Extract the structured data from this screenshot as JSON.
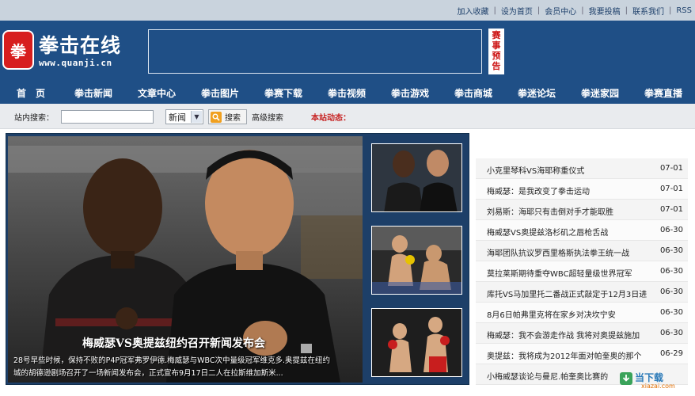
{
  "site": {
    "logo_title": "拳击在线",
    "logo_mark": "拳",
    "logo_url": "www.quanji.cn",
    "promo_tag": "赛事预告"
  },
  "top_links": [
    "加入收藏",
    "设为首页",
    "会员中心",
    "我要投稿",
    "联系我们",
    "RSS"
  ],
  "nav": [
    "首　页",
    "拳击新闻",
    "文章中心",
    "拳击图片",
    "拳赛下载",
    "拳击视频",
    "拳击游戏",
    "拳击商城",
    "拳迷论坛",
    "拳迷家园",
    "拳赛直播"
  ],
  "search": {
    "label": "站内搜索：",
    "value": "",
    "category": "新闻",
    "button": "搜索",
    "advanced": "高级搜索",
    "dynamic_label": "本站动态："
  },
  "slider": {
    "main_title": "梅威瑟VS奥提兹纽约召开新闻发布会",
    "main_text_line1": "28号早些时候，保持不败的P4P冠军弗罗伊德.梅威瑟与WBC次中量级冠军维克多.奥提兹在纽约",
    "main_text_line2": "城的胡德逊剧场召开了一场新闻发布会，正式宣布9月17日二人在拉斯维加斯米..."
  },
  "news": [
    {
      "title": "小克里琴科VS海耶称重仪式",
      "date": "07-01"
    },
    {
      "title": "梅威瑟：是我改变了拳击运动",
      "date": "07-01"
    },
    {
      "title": "刘易斯：海耶只有击倒对手才能取胜",
      "date": "07-01"
    },
    {
      "title": "梅威瑟VS奥提兹洛杉矶之唇枪舌战",
      "date": "06-30"
    },
    {
      "title": "海耶团队抗议罗西里格斯执法拳王统一战",
      "date": "06-30"
    },
    {
      "title": "莫拉莱斯期待重夺WBC超轻量级世界冠军",
      "date": "06-30"
    },
    {
      "title": "库托VS马加里托二番战正式敲定于12月3日进",
      "date": "06-30"
    },
    {
      "title": "8月6日帕弗里克将在家乡对决坎宁安",
      "date": "06-30"
    },
    {
      "title": "梅威瑟：我不会游走作战 我将对奥提兹施加",
      "date": "06-30"
    },
    {
      "title": "奥提兹：我将成为2012年面对帕奎奥的那个",
      "date": "06-29"
    },
    {
      "title": "小梅威瑟谈论与曼尼.帕奎奥比赛的",
      "date": ""
    }
  ],
  "watermark": {
    "text": "当下载",
    "sub": "xiazai.com"
  },
  "colors": {
    "header_blue": "#1f4f86",
    "accent_red": "#c62020",
    "slider_bg": "#1d3f68"
  }
}
